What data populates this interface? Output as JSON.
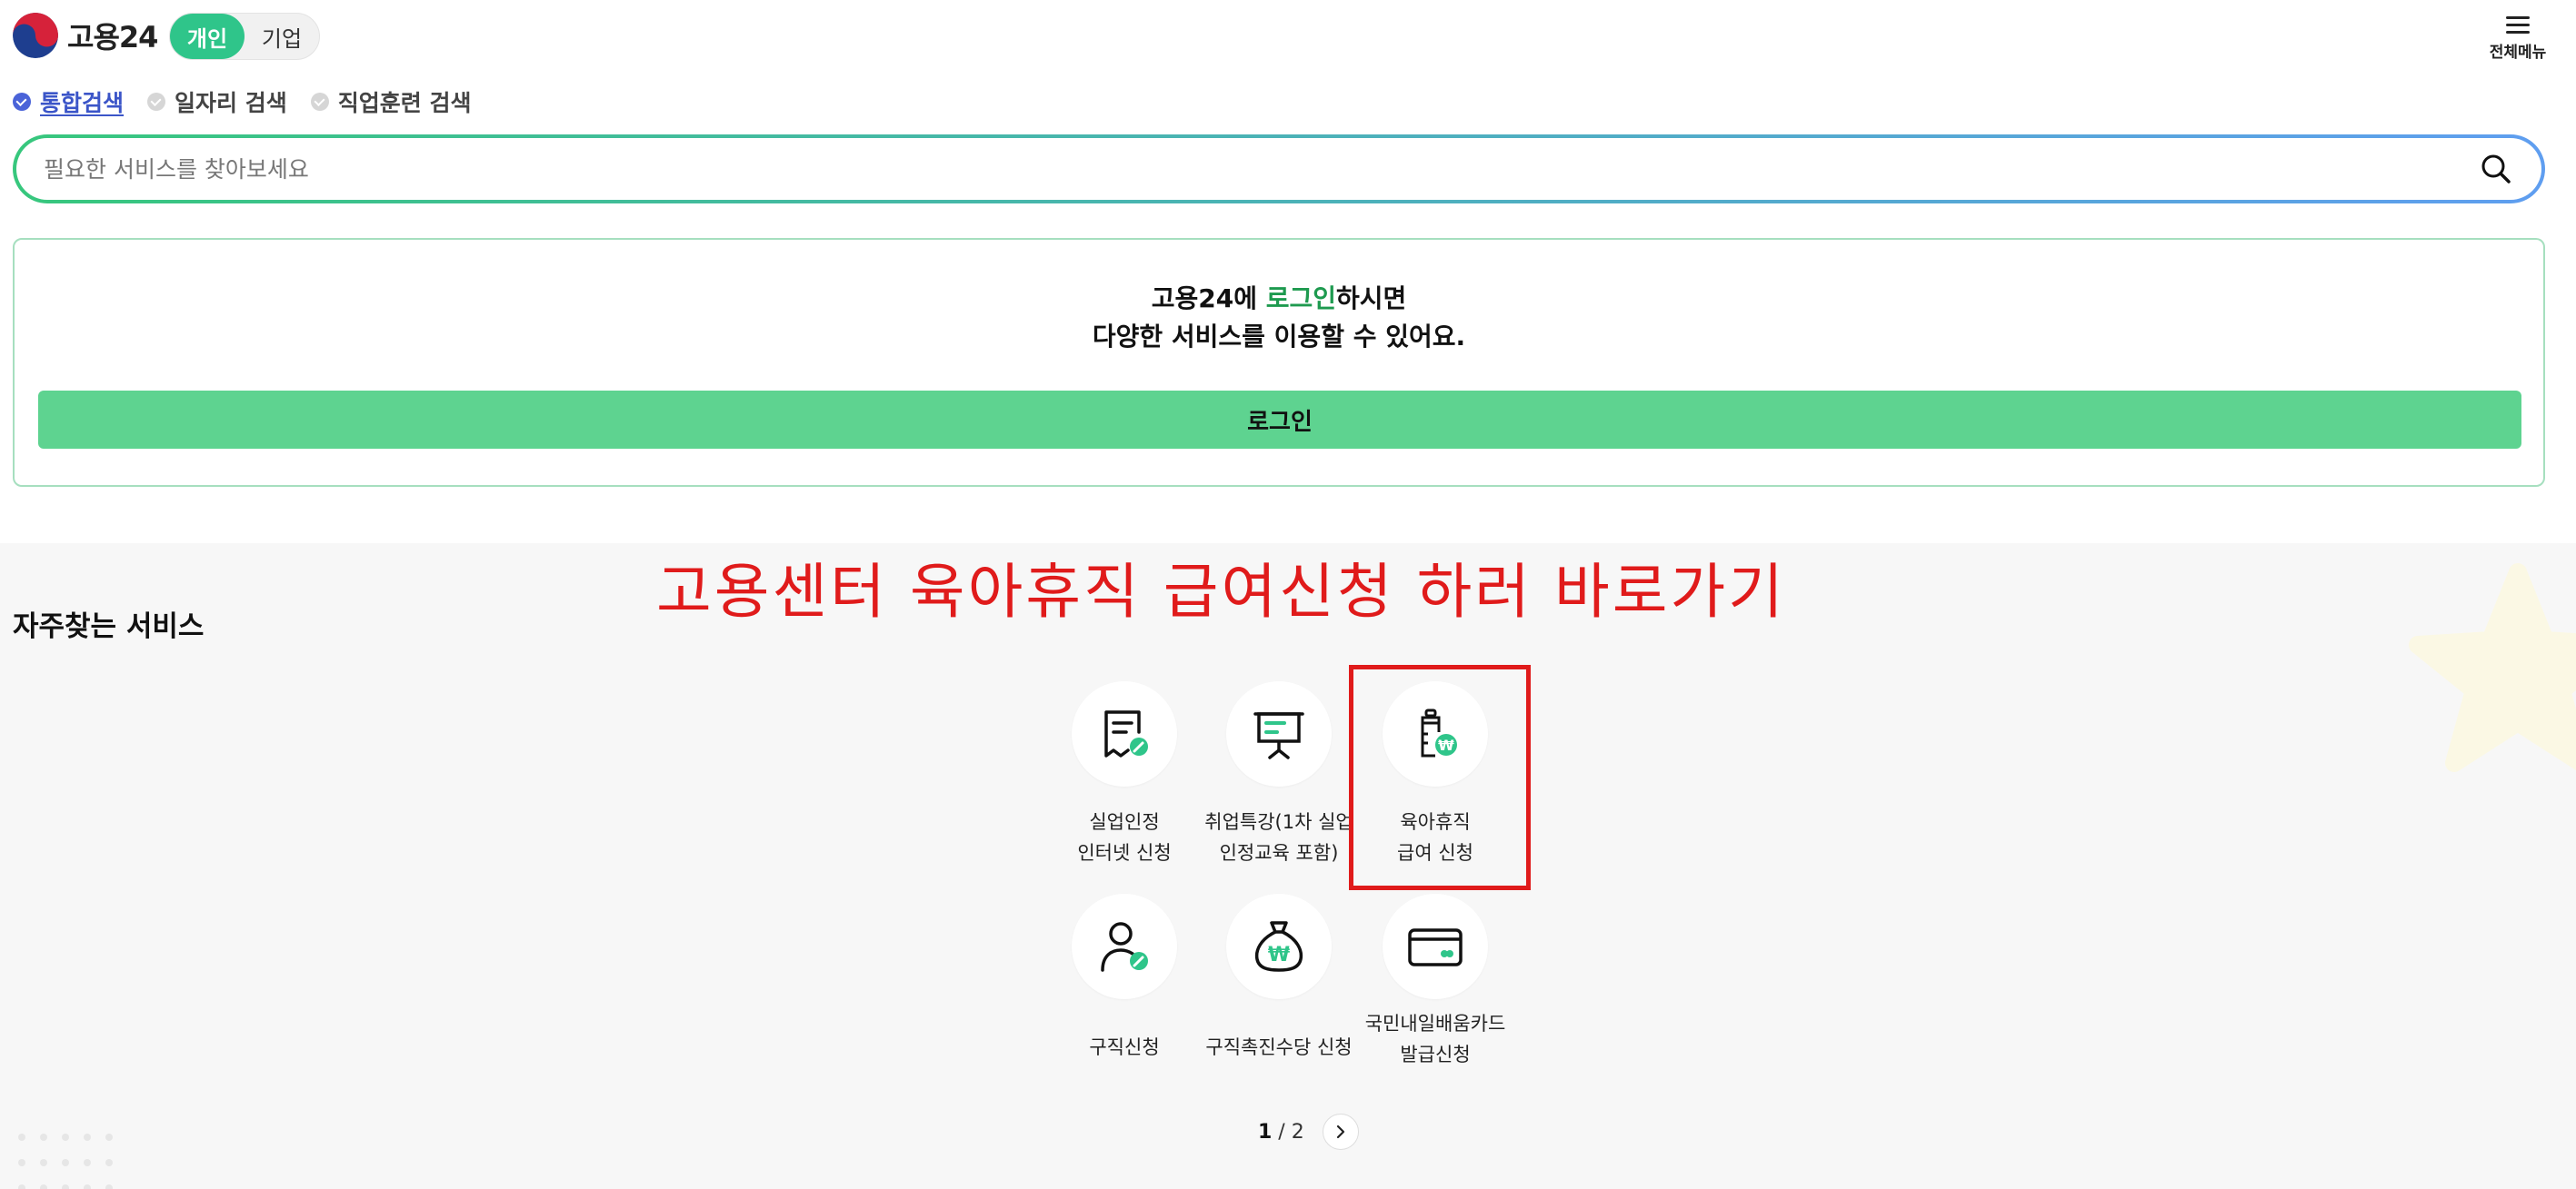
{
  "header": {
    "brand": "고용24",
    "segments": [
      {
        "label": "개인",
        "active": true
      },
      {
        "label": "기업",
        "active": false
      }
    ],
    "menu_label": "전체메뉴"
  },
  "search_scope": [
    {
      "label": "통합검색",
      "active": true
    },
    {
      "label": "일자리 검색",
      "active": false
    },
    {
      "label": "직업훈련 검색",
      "active": false
    }
  ],
  "search": {
    "placeholder": "필요한 서비스를 찾아보세요",
    "value": ""
  },
  "login_card": {
    "line1_prefix": "고용24에 ",
    "line1_highlight": "로그인",
    "line1_suffix": "하시면",
    "line2": "다양한 서비스를 이용할 수 있어요.",
    "button_label": "로그인"
  },
  "frequent_services": {
    "title": "자주찾는 서비스",
    "annotation": "고용센터 육아휴직 급여신청 하러 바로가기",
    "items": [
      {
        "label": "실업인정\n인터넷 신청",
        "icon": "receipt-pen-icon"
      },
      {
        "label": "취업특강(1차 실업\n인정교육 포함)",
        "icon": "presentation-board-icon"
      },
      {
        "label": "육아휴직\n급여 신청",
        "icon": "baby-bottle-won-icon",
        "highlighted": true
      },
      {
        "label": "구직신청",
        "icon": "person-pen-icon"
      },
      {
        "label": "구직촉진수당 신청",
        "icon": "money-bag-won-icon"
      },
      {
        "label": "국민내일배움카드\n발급신청",
        "icon": "card-icon"
      }
    ],
    "pager": {
      "current": "1",
      "total": "2"
    }
  },
  "colors": {
    "brand_green": "#2fc58a",
    "login_button": "#5ed390",
    "annotation_red": "#e01b1b",
    "scope_active": "#4a63d8"
  }
}
